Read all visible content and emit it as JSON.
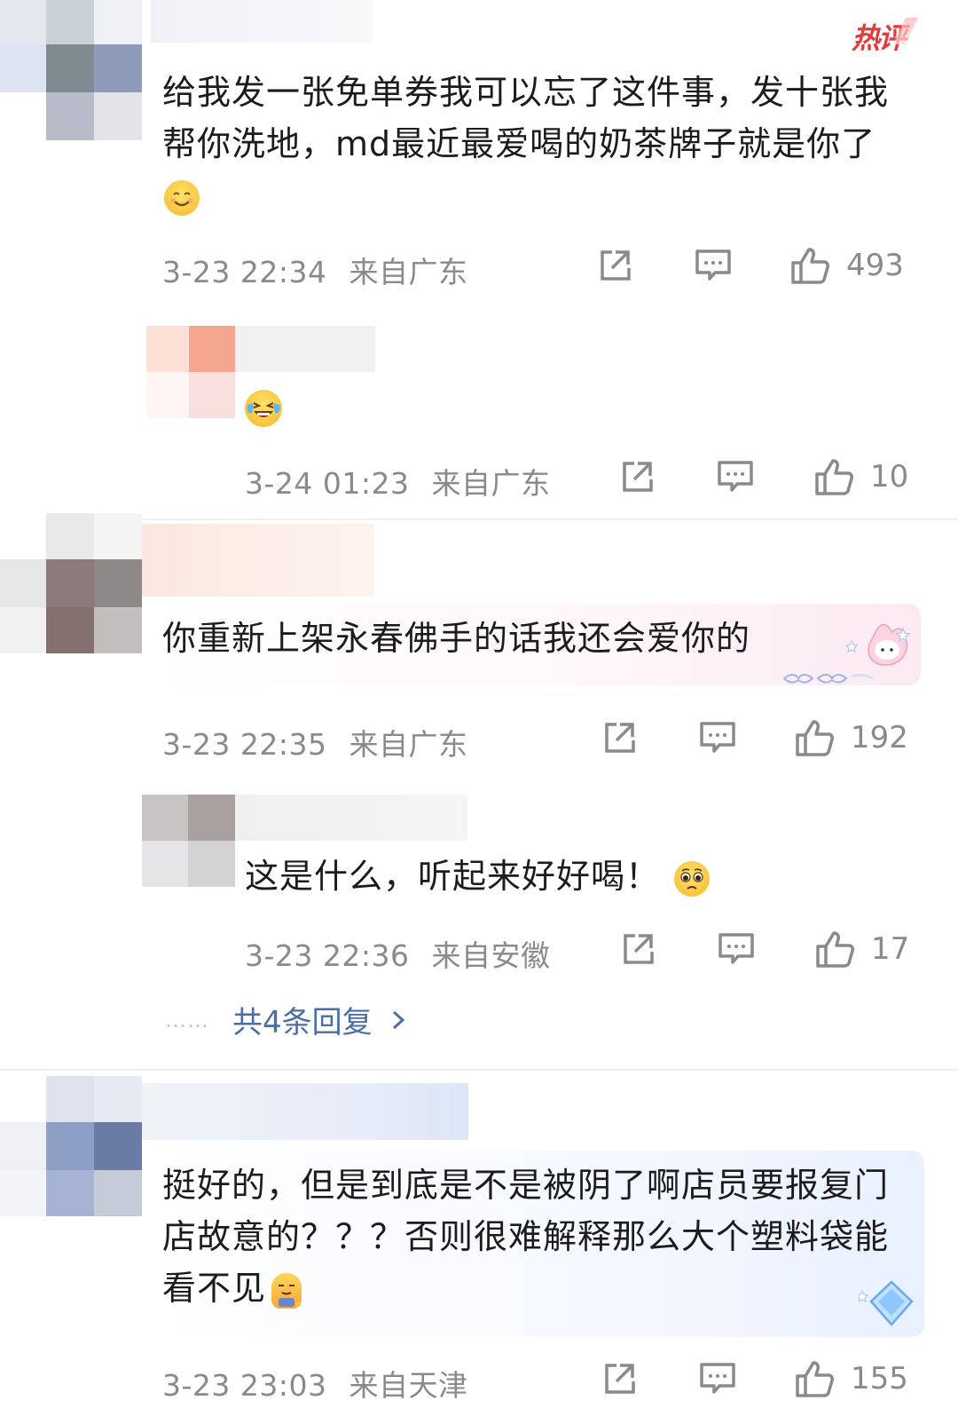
{
  "hot_badge": "热评",
  "comments": [
    {
      "text": "给我发一张免单券我可以忘了这件事，发十张我帮你洗地，md最近最爱喝的奶茶牌子就是你了",
      "emoji": "smile-emoji",
      "time": "3-23 22:34",
      "location": "来自广东",
      "likes": "493"
    },
    {
      "text": "",
      "emoji": "laugh-cry-emoji",
      "time": "3-24 01:23",
      "location": "来自广东",
      "likes": "10"
    },
    {
      "text": "你重新上架永春佛手的话我还会爱你的",
      "time": "3-23 22:35",
      "location": "来自广东",
      "likes": "192"
    },
    {
      "text": "这是什么，听起来好好喝！",
      "emoji": "pleading-emoji",
      "time": "3-23 22:36",
      "location": "来自安徽",
      "likes": "17"
    },
    {
      "text": "挺好的，但是到底是不是被阴了啊店员要报复门店故意的？？？否则很难解释那么大个塑料袋能看不见",
      "emoji": "sigh-emoji",
      "time": "3-23 23:03",
      "location": "来自天津",
      "likes": "155"
    }
  ],
  "replies_link": "共4条回复",
  "replies_dots": "……",
  "icons": {
    "share": "share-icon",
    "comment": "comment-icon",
    "like": "thumbs-up-icon",
    "chevron": "chevron-right-icon"
  },
  "colors": {
    "text": "#1c1c1c",
    "meta": "#8a8a8a",
    "link": "#4a6fa5",
    "hot": "#e53a3a"
  }
}
